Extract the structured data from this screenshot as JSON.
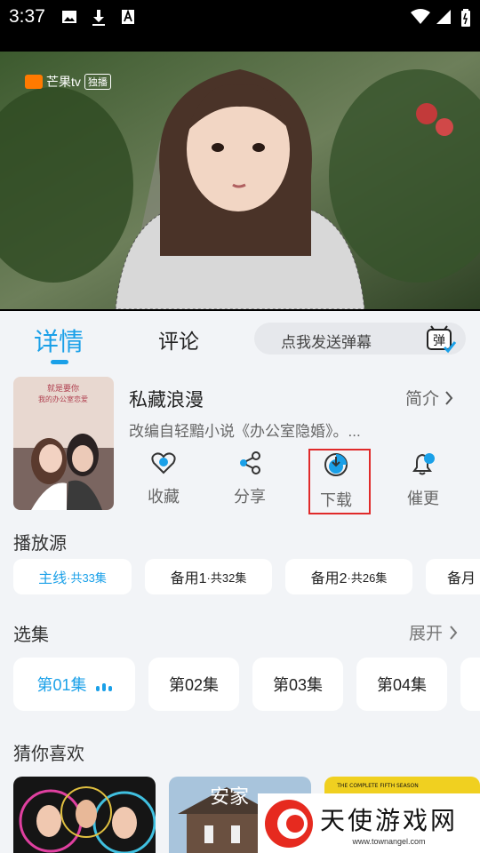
{
  "status_bar": {
    "time": "3:37"
  },
  "video": {
    "watermark_brand": "芒果tv",
    "watermark_tag": "独播"
  },
  "tabs": {
    "details": "详情",
    "comments": "评论"
  },
  "danmu": {
    "placeholder": "点我发送弹幕",
    "button_glyph": "弹"
  },
  "show": {
    "title": "私藏浪漫",
    "intro_label": "简介",
    "description": "改编自轻黯小说《办公室隐婚》。...",
    "poster_text_1": "就是要你",
    "poster_text_2": "我的办公室恋爱"
  },
  "actions": [
    {
      "label": "收藏",
      "icon": "heart-icon"
    },
    {
      "label": "分享",
      "icon": "share-icon"
    },
    {
      "label": "下载",
      "icon": "download-icon"
    },
    {
      "label": "催更",
      "icon": "bell-icon"
    }
  ],
  "sources": {
    "title": "播放源",
    "items": [
      {
        "name": "主线",
        "count": "·共33集"
      },
      {
        "name": "备用1",
        "count": "·共32集"
      },
      {
        "name": "备用2",
        "count": "·共26集"
      },
      {
        "name": "备月",
        "count": ""
      }
    ]
  },
  "episodes": {
    "title": "选集",
    "expand_label": "展开",
    "items": [
      "第01集",
      "第02集",
      "第03集",
      "第04集"
    ]
  },
  "recommend": {
    "title": "猜你喜欢",
    "card2_text": "安家",
    "card3_text": "THE COMPLETE FIFTH SEASON"
  },
  "site_logo": {
    "name": "天使游戏网",
    "url": "www.townangel.com"
  },
  "colors": {
    "accent": "#1aa0e8",
    "highlight": "#e02a2a"
  }
}
